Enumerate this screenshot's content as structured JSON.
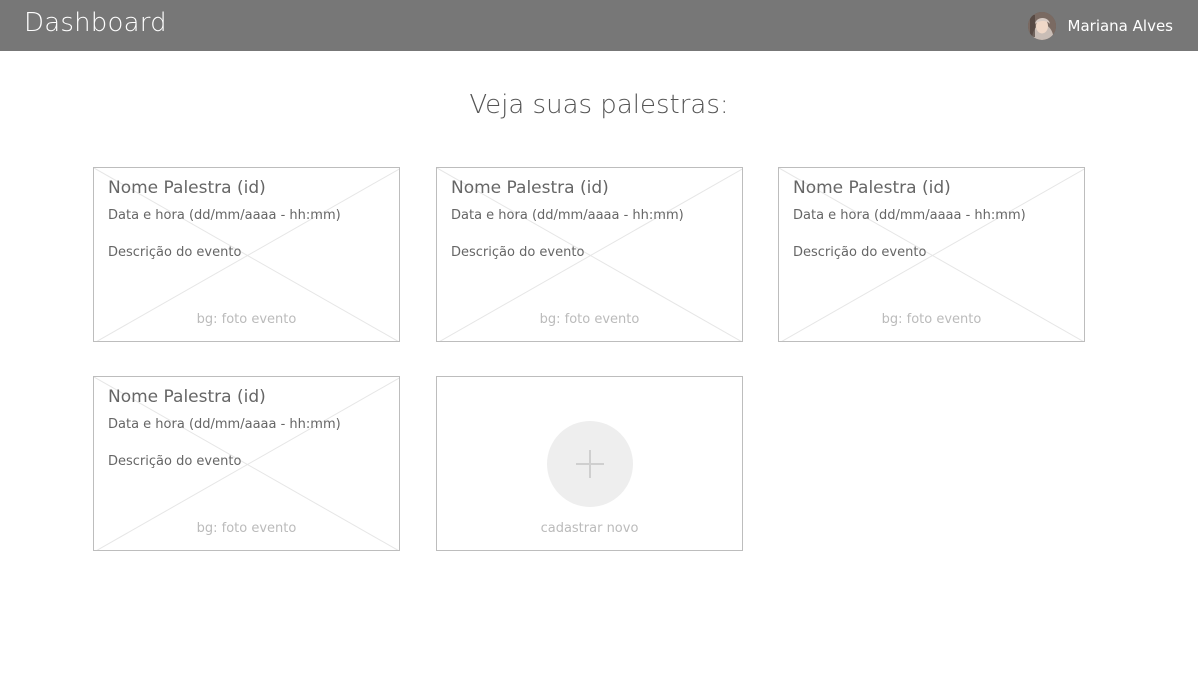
{
  "header": {
    "title": "Dashboard",
    "user_name": "Mariana Alves",
    "avatar_icon": "user-avatar"
  },
  "main": {
    "heading": "Veja suas palestras:"
  },
  "cards": [
    {
      "name": "Nome Palestra (id)",
      "datetime": "Data e hora (dd/mm/aaaa - hh:mm)",
      "description": "Descrição do evento",
      "background_note": "bg: foto evento"
    },
    {
      "name": "Nome Palestra (id)",
      "datetime": "Data e hora (dd/mm/aaaa - hh:mm)",
      "description": "Descrição do evento",
      "background_note": "bg: foto evento"
    },
    {
      "name": "Nome Palestra (id)",
      "datetime": "Data e hora (dd/mm/aaaa - hh:mm)",
      "description": "Descrição do evento",
      "background_note": "bg: foto evento"
    },
    {
      "name": "Nome Palestra (id)",
      "datetime": "Data e hora (dd/mm/aaaa - hh:mm)",
      "description": "Descrição do evento",
      "background_note": "bg: foto evento"
    }
  ],
  "new_card": {
    "label": "cadastrar novo",
    "icon": "plus-icon"
  },
  "colors": {
    "header_bg": "#777777",
    "card_border": "#bdbdbd",
    "text": "#666666",
    "muted": "#bbbbbb"
  }
}
